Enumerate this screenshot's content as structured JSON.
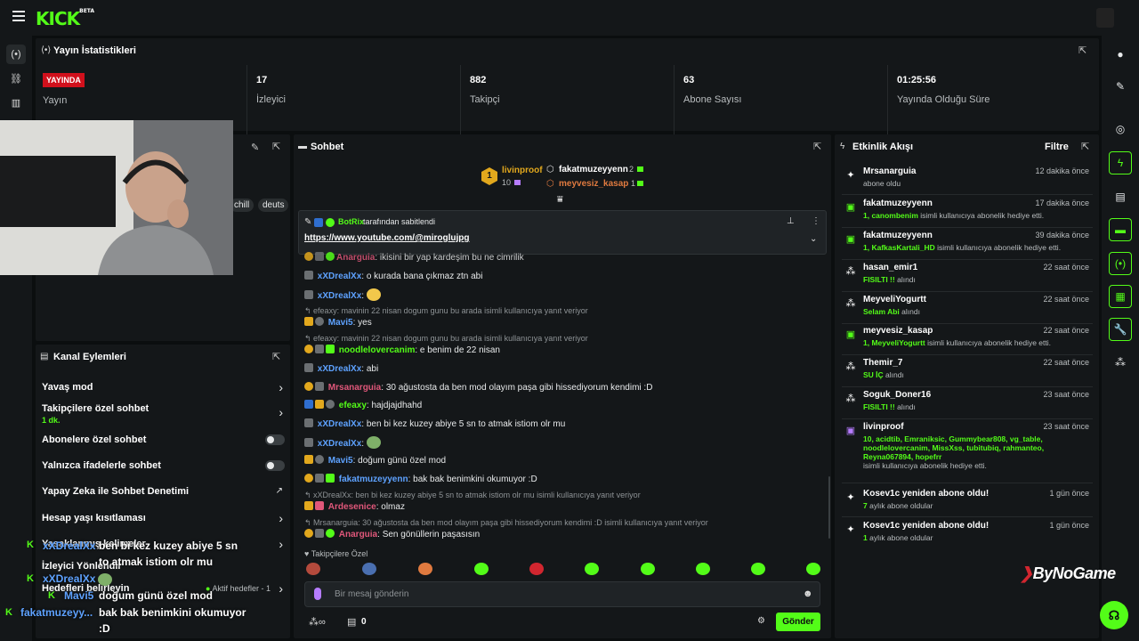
{
  "topbar": {
    "logo": "KICK",
    "logo_beta": "BETA"
  },
  "stats": {
    "title": "Yayın İstatistikleri",
    "live_badge": "YAYINDA",
    "stream_label": "Yayın",
    "viewers_value": "17",
    "viewers_label": "İzleyici",
    "followers_value": "882",
    "followers_label": "Takipçi",
    "subs_value": "63",
    "subs_label": "Abone Sayısı",
    "uptime_value": "01:25:56",
    "uptime_label": "Yayında Olduğu Süre"
  },
  "stream_info": {
    "tag1": "chill",
    "tag2": "deuts"
  },
  "channel_actions": {
    "title": "Kanal Eylemleri",
    "slow_mode": "Yavaş mod",
    "followers_only": "Takipçilere özel sohbet",
    "followers_only_sub": "1 dk.",
    "subs_only": "Abonelere özel sohbet",
    "emotes_only": "Yalnızca ifadelerle sohbet",
    "ai_moderation": "Yapay Zeka ile Sohbet Denetimi",
    "account_age": "Hesap yaşı kısıtlaması",
    "blocked_words": "Yasaklanmış kelimeler",
    "viewer_manager": "İzleyici Yönlendir",
    "goals": "Hedefleri belirleyin",
    "goals_active": "Aktif hedefler - 1"
  },
  "overlay_chat": [
    {
      "user": "xXDrealXx",
      "text": "ben bi kez kuzey abiye 5 sn"
    },
    {
      "user": "",
      "text": "to atmak istiom olr mu"
    },
    {
      "user": "xXDrealXx",
      "text": ""
    },
    {
      "user": "Mavi5",
      "text": "doğum günü özel mod"
    },
    {
      "user": "fakatmuzeyy...",
      "text": "bak bak benimkini okumuyor"
    },
    {
      "user": "",
      "text": ":D"
    }
  ],
  "chat": {
    "title": "Sohbet",
    "top_gifter_1": {
      "name": "livinproof",
      "count": "10"
    },
    "top_gifter_2": {
      "name": "fakatmuzeyyenn",
      "count": "2"
    },
    "top_gifter_3": {
      "name": "meyvesiz_kasap",
      "count": "1"
    },
    "pinned_by": "BotRix",
    "pinned_suffix": "tarafından sabitlendi",
    "pinned_link": "https://www.youtube.com/@miroglujpg",
    "partial_line": "ikisini bir yap kardeşim bu ne cimrilik",
    "partial_user": "Anarguia",
    "messages": [
      {
        "user": "xXDrealXx",
        "text": "o kurada bana çıkmaz ztn abi"
      },
      {
        "user": "xXDrealXx",
        "text": ""
      },
      {
        "reply": "efeaxy: mavinin 22 nisan dogum gunu bu arada isimli kullanıcıya yanıt veriyor"
      },
      {
        "user": "Mavi5",
        "text": "yes"
      },
      {
        "reply": "efeaxy: mavinin 22 nisan dogum gunu bu arada isimli kullanıcıya yanıt veriyor"
      },
      {
        "user": "noodlelovercanim",
        "text": "e benim de 22 nisan"
      },
      {
        "user": "xXDrealXx",
        "text": "abi"
      },
      {
        "user": "Mrsanarguia",
        "text": "30 ağustosta da ben mod olayım paşa gibi hissediyorum kendimi :D"
      },
      {
        "user": "efeaxy",
        "text": "hajdjajdhahd"
      },
      {
        "user": "xXDrealXx",
        "text": "ben bi kez kuzey abiye 5 sn to atmak istiom olr mu"
      },
      {
        "user": "xXDrealXx",
        "text": ""
      },
      {
        "user": "Mavi5",
        "text": "doğum günü özel mod"
      },
      {
        "user": "fakatmuzeyyenn",
        "text": "bak bak benimkini okumuyor :D"
      },
      {
        "reply": "xXDrealXx: ben bi kez kuzey abiye 5 sn to atmak istiom olr mu isimli kullanıcıya yanıt veriyor"
      },
      {
        "user": "Ardesenice",
        "text": "olmaz"
      },
      {
        "reply": "Mrsanarguia: 30 ağustosta da ben mod olayım paşa gibi hissediyorum kendimi :D isimli kullanıcıya yanıt veriyor"
      },
      {
        "user": "Anarguia",
        "text": "Sen gönüllerin paşasısın"
      }
    ],
    "followers_label": "Takipçilere Özel",
    "input_placeholder": "Bir mesaj gönderin",
    "points": "0",
    "send_label": "Gönder"
  },
  "activity": {
    "title": "Etkinlik Akışı",
    "filter": "Filtre",
    "items": [
      {
        "name": "Mrsanarguia",
        "time": "12 dakika önce",
        "line1": "abone oldu",
        "hl": ""
      },
      {
        "name": "fakatmuzeyyenn",
        "time": "17 dakika önce",
        "hl": "1, canombenim",
        "line1": " isimli kullanıcıya abonelik hediye etti."
      },
      {
        "name": "fakatmuzeyyenn",
        "time": "39 dakika önce",
        "hl": "1, KafkasKartali_HD",
        "line1": " isimli kullanıcıya abonelik hediye etti."
      },
      {
        "name": "hasan_emir1",
        "time": "22 saat önce",
        "hl": "FISILTI !!",
        "line1": " alındı"
      },
      {
        "name": "MeyveliYogurtt",
        "time": "22 saat önce",
        "hl": "Selam Abi",
        "line1": " alındı"
      },
      {
        "name": "meyvesiz_kasap",
        "time": "22 saat önce",
        "hl": "1, MeyveliYogurtt",
        "line1": " isimli kullanıcıya abonelik hediye etti."
      },
      {
        "name": "Themir_7",
        "time": "22 saat önce",
        "hl": "SU İÇ",
        "line1": " alındı"
      },
      {
        "name": "Soguk_Doner16",
        "time": "23 saat önce",
        "hl": "FISILTI !!",
        "line1": " alındı"
      },
      {
        "name": "livinproof",
        "time": "23 saat önce",
        "hl": "10, acidtib, Emraniksic, Gummybear808, vg_table, noodlelovercanim, MissXss, tubitubiq, rahmanteo, Reyna067894, hopefrr",
        "line1": " isimli kullanıcıya abonelik hediye etti."
      },
      {
        "name": "Kosev1c yeniden abone oldu!",
        "time": "1 gün önce",
        "hl": "7",
        "line1": " aylık abone oldular"
      },
      {
        "name": "Kosev1c yeniden abone oldu!",
        "time": "1 gün önce",
        "hl": "1",
        "line1": " aylık abone oldular"
      }
    ]
  },
  "watermark": "ByNoGame",
  "colors": {
    "accent": "#53fc18",
    "live": "#d1101c",
    "panel": "#141719",
    "bg": "#0b0e0f"
  }
}
